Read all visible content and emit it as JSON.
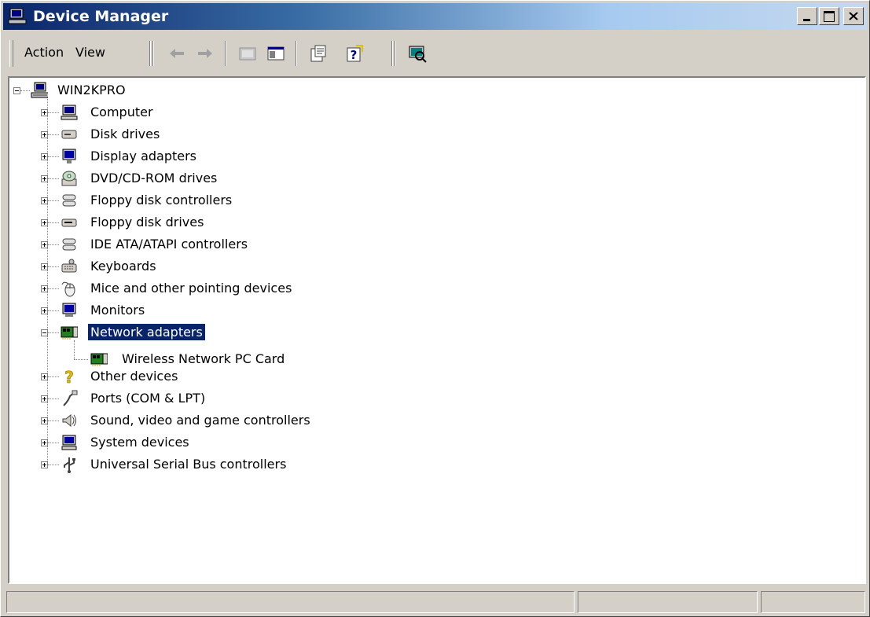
{
  "window": {
    "title": "Device Manager"
  },
  "menu": {
    "action": "Action",
    "view": "View"
  },
  "toolbar": {
    "buttons": [
      "back-arrow-icon",
      "forward-arrow-icon",
      "up-folder-icon",
      "show-hide-tree-icon",
      "properties-icon",
      "help-icon",
      "scan-hardware-icon"
    ]
  },
  "tree": {
    "root": "WIN2KPRO",
    "categories": [
      {
        "label": "Computer",
        "icon": "computer-icon"
      },
      {
        "label": "Disk drives",
        "icon": "disk-drive-icon"
      },
      {
        "label": "Display adapters",
        "icon": "display-adapter-icon"
      },
      {
        "label": "DVD/CD-ROM drives",
        "icon": "cdrom-icon"
      },
      {
        "label": "Floppy disk controllers",
        "icon": "controller-icon"
      },
      {
        "label": "Floppy disk drives",
        "icon": "floppy-drive-icon"
      },
      {
        "label": "IDE ATA/ATAPI controllers",
        "icon": "controller-icon"
      },
      {
        "label": "Keyboards",
        "icon": "keyboard-icon"
      },
      {
        "label": "Mice and other pointing devices",
        "icon": "mouse-icon"
      },
      {
        "label": "Monitors",
        "icon": "monitor-icon"
      },
      {
        "label": "Network adapters",
        "icon": "network-card-icon",
        "selected": true,
        "expanded": true
      },
      {
        "label": "Other devices",
        "icon": "question-icon"
      },
      {
        "label": "Ports (COM & LPT)",
        "icon": "port-icon"
      },
      {
        "label": "Sound, video and game controllers",
        "icon": "speaker-icon"
      },
      {
        "label": "System devices",
        "icon": "system-icon"
      },
      {
        "label": "Universal Serial Bus controllers",
        "icon": "usb-icon"
      }
    ],
    "network_child": "Wireless Network PC Card"
  },
  "colors": {
    "selection": "#0a246a",
    "title_start": "#0a246a",
    "title_end": "#a6caf0"
  }
}
